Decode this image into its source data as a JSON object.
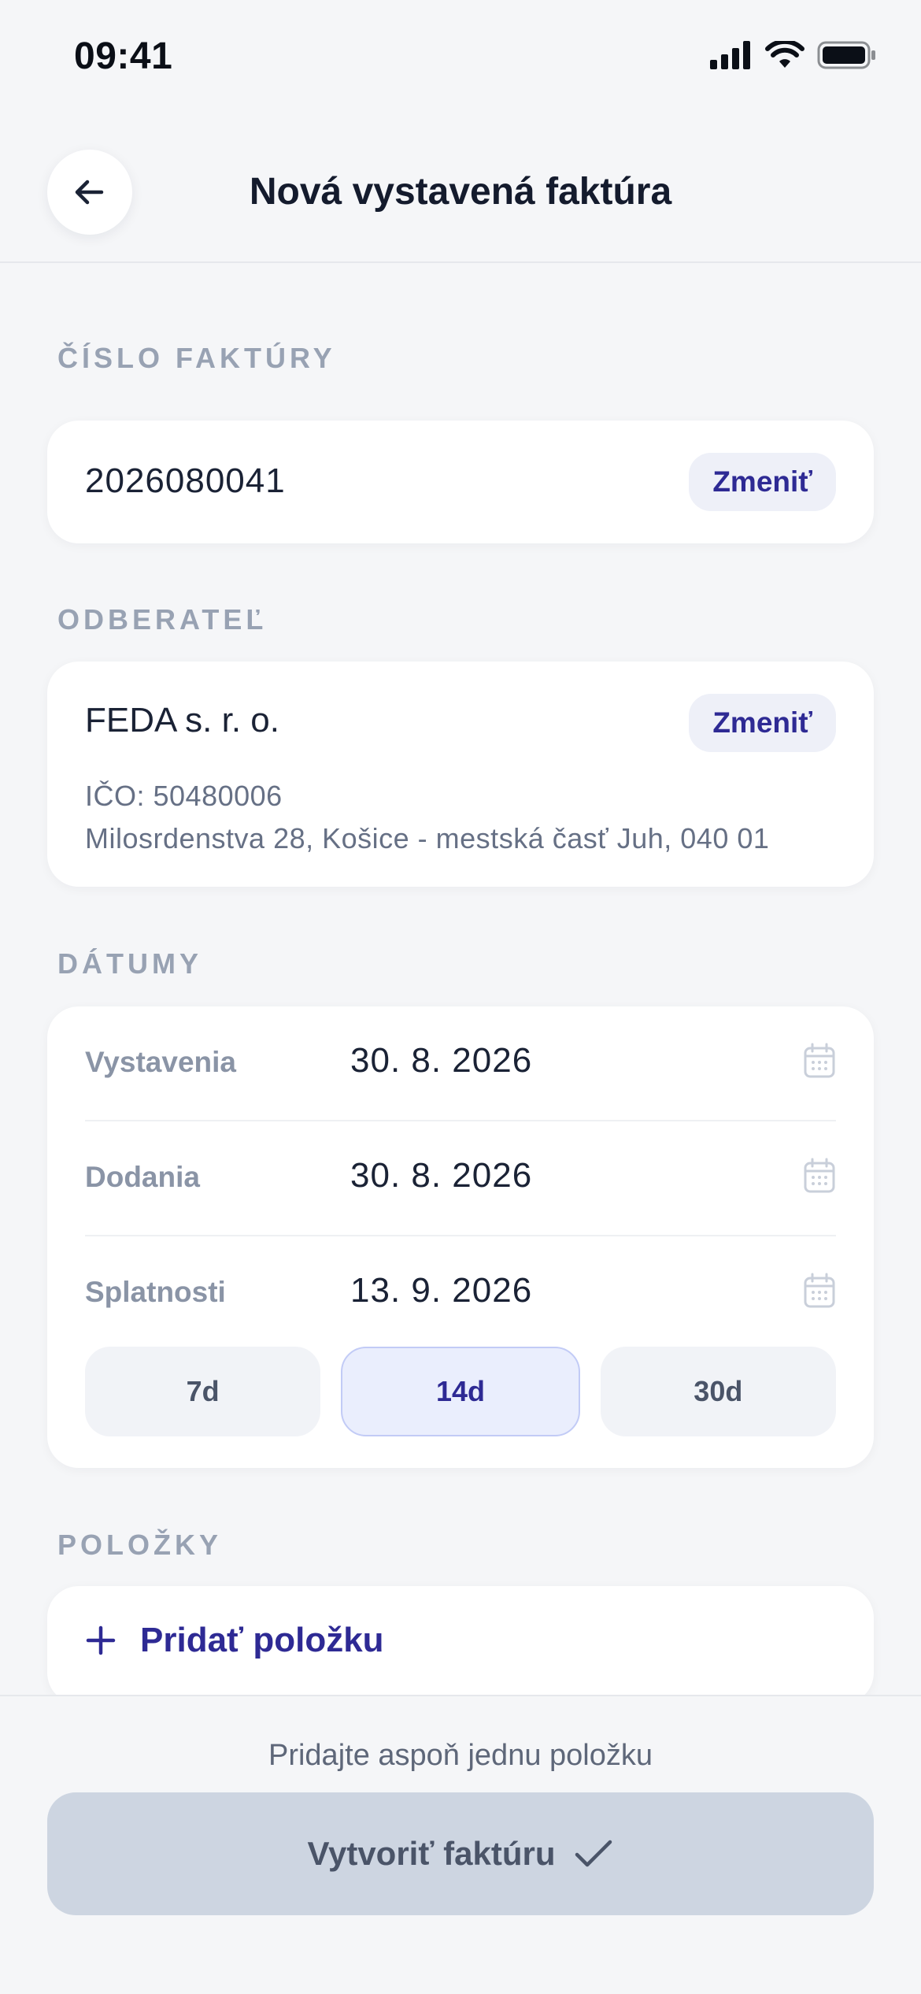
{
  "status_bar": {
    "time": "09:41",
    "icons": [
      "signal-icon",
      "wifi-icon",
      "battery-icon"
    ]
  },
  "header": {
    "title": "Nová vystavená faktúra",
    "back_icon": "arrow-left-icon"
  },
  "invoice_number": {
    "section_label": "ČÍSLO FAKTÚRY",
    "value": "2026080041",
    "change_label": "Zmeniť"
  },
  "client": {
    "section_label": "ODBERATEĽ",
    "name": "FEDA s. r. o.",
    "ico": "IČO: 50480006",
    "address": "Milosrdenstva 28, Košice - mestská časť Juh, 040 01",
    "change_label": "Zmeniť"
  },
  "dates": {
    "section_label": "DÁTUMY",
    "rows": [
      {
        "label": "Vystavenia",
        "value": "30. 8. 2026",
        "icon": "calendar-icon"
      },
      {
        "label": "Dodania",
        "value": "30. 8. 2026",
        "icon": "calendar-icon"
      },
      {
        "label": "Splatnosti",
        "value": "13. 9. 2026",
        "icon": "calendar-icon"
      }
    ],
    "due_presets": [
      {
        "label": "7d",
        "selected": false
      },
      {
        "label": "14d",
        "selected": true
      },
      {
        "label": "30d",
        "selected": false
      }
    ]
  },
  "items": {
    "section_label": "POLOŽKY",
    "add_label": "Pridať položku",
    "add_icon": "plus-icon"
  },
  "footer": {
    "hint": "Pridajte aspoň jednu položku",
    "submit_label": "Vytvoriť faktúru",
    "submit_icon": "check-icon",
    "submit_enabled": false
  },
  "colors": {
    "accent": "#2E2A94",
    "background": "#F5F6F8",
    "section_label": "#98A2B3",
    "disabled_button": "#CDD5E1"
  }
}
